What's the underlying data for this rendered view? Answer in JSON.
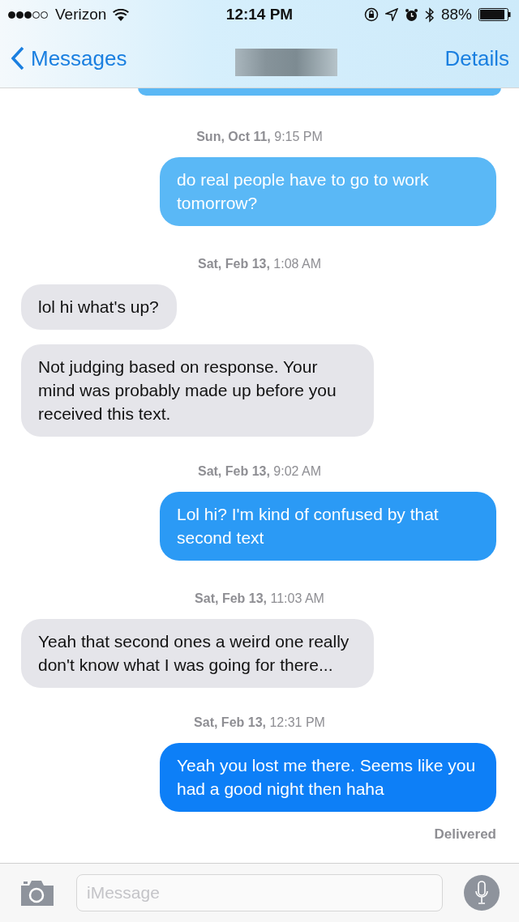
{
  "status_bar": {
    "carrier": "Verizon",
    "time": "12:14 PM",
    "battery": "88%"
  },
  "nav": {
    "back": "Messages",
    "action": "Details"
  },
  "messages": [
    {
      "kind": "timestamp",
      "text": "**Sun, Oct 11,** 9:15 PM"
    },
    {
      "kind": "outgoing",
      "text": "do real people have to go to work tomorrow?"
    },
    {
      "kind": "timestamp",
      "text": "**Sat, Feb 13,** 1:08 AM"
    },
    {
      "kind": "incoming",
      "text": "lol hi what's up?"
    },
    {
      "kind": "incoming",
      "text": "Not judging based on response. Your mind was probably made up before you received this text."
    },
    {
      "kind": "timestamp",
      "text": "**Sat, Feb 13,** 9:02 AM"
    },
    {
      "kind": "outgoing",
      "text": "Lol hi? I'm kind of confused by that second text"
    },
    {
      "kind": "timestamp",
      "text": "**Sat, Feb 13,** 11:03 AM"
    },
    {
      "kind": "incoming",
      "text": "Yeah that second ones a weird one really don't know what I was going for there..."
    },
    {
      "kind": "timestamp",
      "text": "**Sat, Feb 13,** 12:31 PM"
    },
    {
      "kind": "outgoing",
      "text": "Yeah you lost me there. Seems like you had a good night then haha"
    },
    {
      "kind": "receipt",
      "text": "Delivered"
    }
  ],
  "composer": {
    "placeholder": "iMessage"
  }
}
